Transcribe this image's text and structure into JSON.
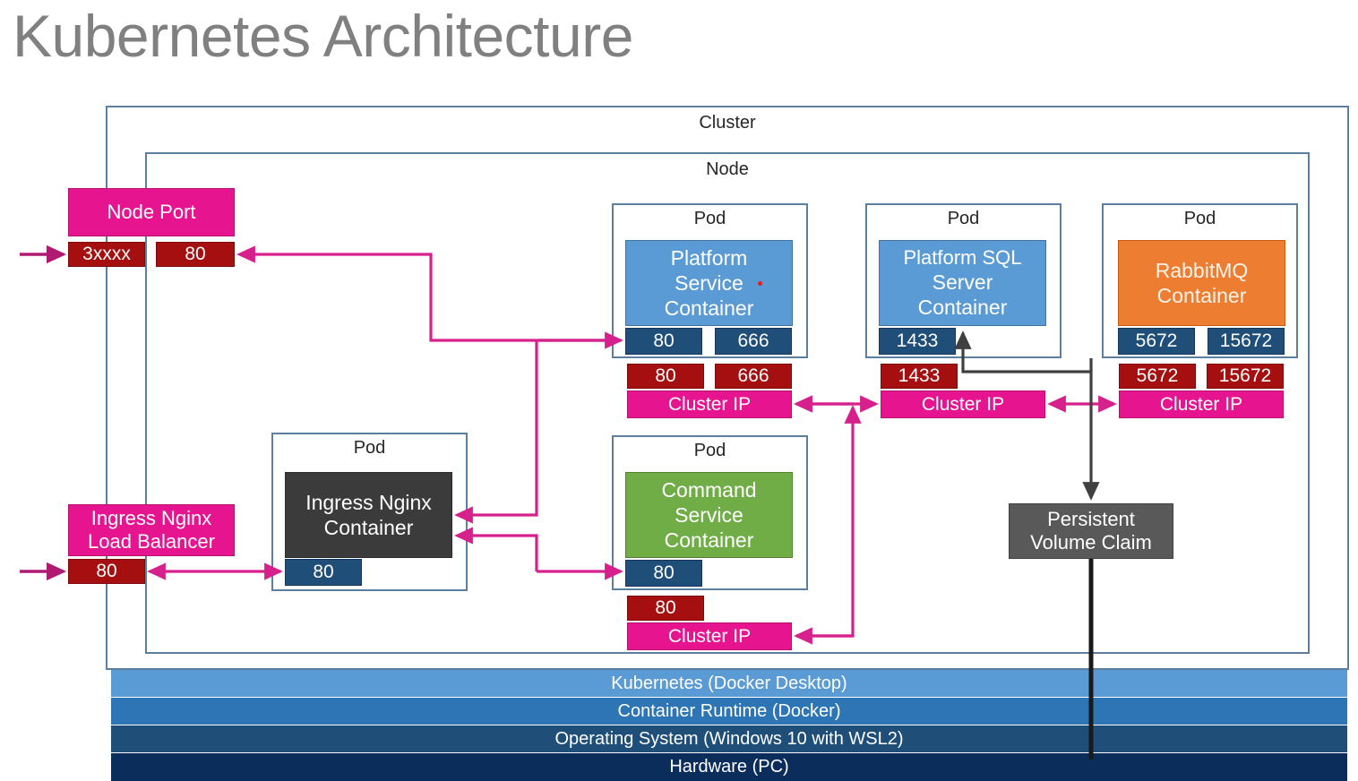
{
  "page": {
    "title": "Kubernetes Architecture"
  },
  "colors": {
    "frame_border": "#5b7f9c",
    "service_pink": "#e6158f",
    "port_red": "#a50f0f",
    "port_blue": "#1f4e79",
    "container_blue": "#5b9bd5",
    "container_green": "#70ad47",
    "container_orange": "#ed7d31",
    "container_dark": "#3b3b3b",
    "pvc_gray": "#595959",
    "arrow_pink": "#d6218c",
    "arrow_gray": "#404040",
    "title_gray": "#808080"
  },
  "cluster": {
    "label": "Cluster"
  },
  "node": {
    "label": "Node"
  },
  "external_services": {
    "node_port": {
      "name": "Node Port",
      "ports": [
        {
          "label": "3xxxx"
        },
        {
          "label": "80"
        }
      ]
    },
    "load_balancer": {
      "name_line1": "Ingress Nginx",
      "name_line2": "Load Balancer",
      "ports": [
        {
          "label": "80"
        }
      ]
    }
  },
  "pods": [
    {
      "pod_label": "Pod",
      "container": {
        "name": "Platform Service Container",
        "line1": "Platform",
        "line2": "Service",
        "line3": "Container",
        "color": "#5b9bd5"
      },
      "container_ports": [
        {
          "label": "80"
        },
        {
          "label": "666"
        }
      ],
      "service": {
        "name": "Cluster IP",
        "ports": [
          {
            "label": "80"
          },
          {
            "label": "666"
          }
        ]
      }
    },
    {
      "pod_label": "Pod",
      "container": {
        "name": "Platform SQL Server Container",
        "line1": "Platform SQL",
        "line2": "Server",
        "line3": "Container",
        "color": "#5b9bd5"
      },
      "container_ports": [
        {
          "label": "1433"
        }
      ],
      "service": {
        "name": "Cluster IP",
        "ports": [
          {
            "label": "1433"
          }
        ]
      }
    },
    {
      "pod_label": "Pod",
      "container": {
        "name": "RabbitMQ Container",
        "line1": "RabbitMQ",
        "line2": "Container",
        "line3": "",
        "color": "#ed7d31"
      },
      "container_ports": [
        {
          "label": "5672"
        },
        {
          "label": "15672"
        }
      ],
      "service": {
        "name": "Cluster IP",
        "ports": [
          {
            "label": "5672"
          },
          {
            "label": "15672"
          }
        ]
      }
    },
    {
      "pod_label": "Pod",
      "container": {
        "name": "Ingress Nginx Container",
        "line1": "Ingress Nginx",
        "line2": "Container",
        "line3": "",
        "color": "#3b3b3b"
      },
      "container_ports": [
        {
          "label": "80"
        }
      ],
      "service": null
    },
    {
      "pod_label": "Pod",
      "container": {
        "name": "Command Service Container",
        "line1": "Command",
        "line2": "Service",
        "line3": "Container",
        "color": "#70ad47"
      },
      "container_ports": [
        {
          "label": "80"
        }
      ],
      "service": {
        "name": "Cluster IP",
        "ports": [
          {
            "label": "80"
          }
        ]
      }
    }
  ],
  "storage": {
    "pvc_line1": "Persistent",
    "pvc_line2": "Volume Claim"
  },
  "infrastructure_stack": [
    {
      "label": "Kubernetes (Docker Desktop)",
      "color": "#5b9bd5"
    },
    {
      "label": "Container Runtime (Docker)",
      "color": "#2e75b6"
    },
    {
      "label": "Operating System (Windows 10 with WSL2)",
      "color": "#1f4e79"
    },
    {
      "label": "Hardware (PC)",
      "color": "#0b2d5c"
    }
  ]
}
